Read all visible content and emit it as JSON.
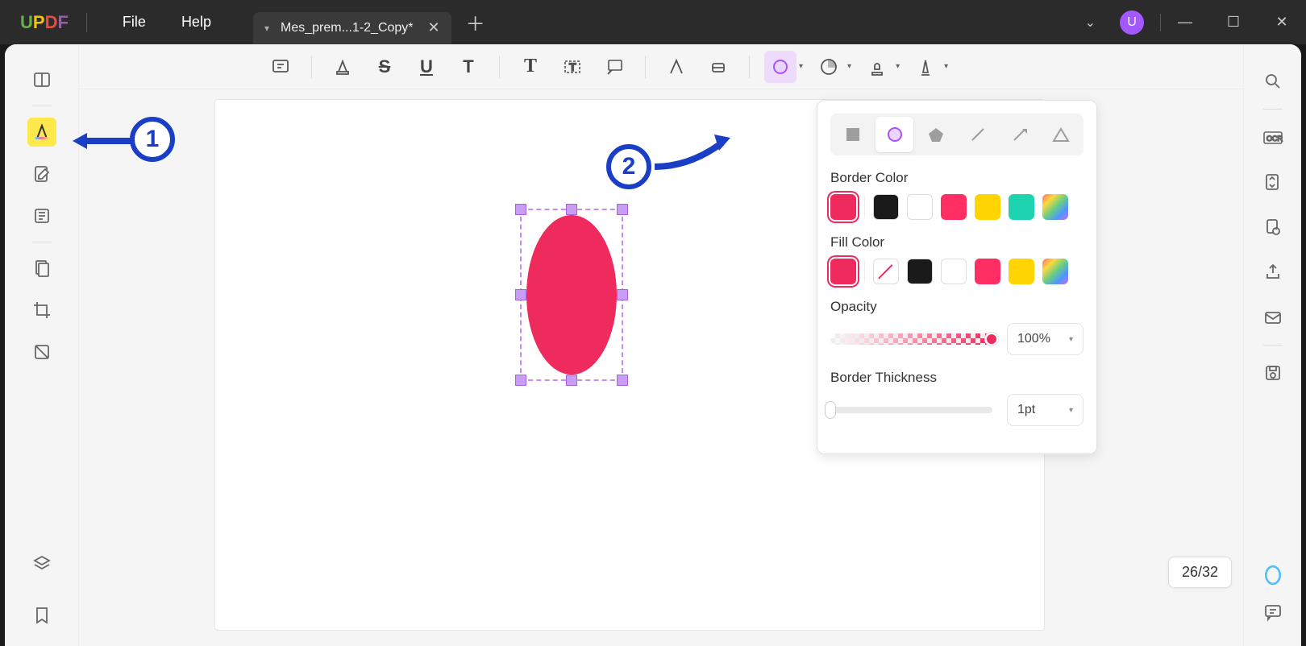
{
  "app": {
    "logo_u": "U",
    "logo_p": "P",
    "logo_d": "D",
    "logo_f": "F"
  },
  "menu": {
    "file": "File",
    "help": "Help"
  },
  "tab": {
    "title": "Mes_prem...1-2_Copy*"
  },
  "avatar": {
    "letter": "U"
  },
  "popover": {
    "border_label": "Border Color",
    "fill_label": "Fill Color",
    "opacity_label": "Opacity",
    "opacity_value": "100%",
    "thickness_label": "Border Thickness",
    "thickness_value": "1pt",
    "border_colors": [
      "#EF2A5D",
      "#1a1a1a",
      "#ffffff",
      "#ff2e63",
      "#ffd400",
      "#1dd3b0"
    ],
    "fill_colors": [
      "#EF2A5D",
      "none",
      "#1a1a1a",
      "#ffffff",
      "#ff2e63",
      "#ffd400"
    ]
  },
  "annotations": {
    "one": "1",
    "two": "2"
  },
  "pager": {
    "value": "26/32"
  }
}
